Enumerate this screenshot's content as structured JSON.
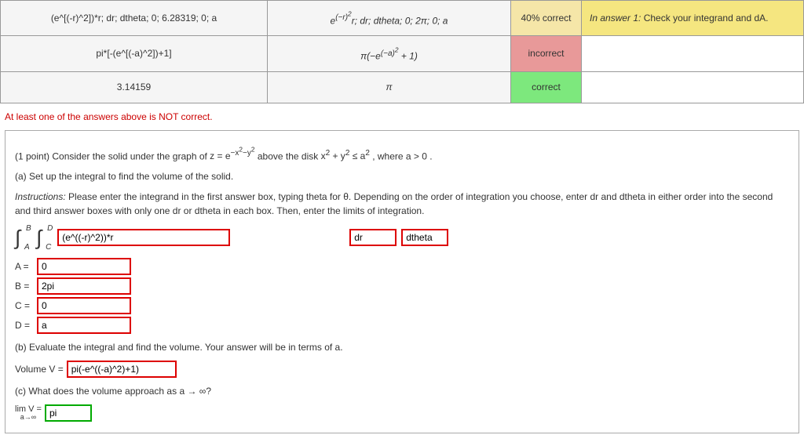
{
  "results": {
    "rows": [
      {
        "entered": "(e^[(-r)^2])*r; dr; dtheta; 0; 6.28319; 0; a",
        "preview_html": "e<sup>(−r)<sup>2</sup></sup>r; dr; dtheta; 0; 2π; 0; a",
        "status": "40% correct",
        "status_class": "status-partial",
        "hint_prefix": "In answer 1:",
        "hint": "Check your integrand and dA."
      },
      {
        "entered": "pi*[-(e^[(-a)^2])+1]",
        "preview_html": "π(−e<sup>(−a)<sup>2</sup></sup> + 1)",
        "status": "incorrect",
        "status_class": "status-incorrect",
        "hint_prefix": "",
        "hint": ""
      },
      {
        "entered": "3.14159",
        "preview_html": "π",
        "status": "correct",
        "status_class": "status-correct",
        "hint_prefix": "",
        "hint": ""
      }
    ]
  },
  "warning": "At least one of the answers above is NOT correct.",
  "problem": {
    "points": "(1 point)",
    "stem1": "Consider the solid under the graph of ",
    "stem_eq_html": "z = e<sup>−x<sup>2</sup>−y<sup>2</sup></sup>",
    "stem2": " above the disk ",
    "stem_disk_html": "x<sup>2</sup> + y<sup>2</sup> ≤ a<sup>2</sup>",
    "stem3": ", where ",
    "stem_cond": "a > 0",
    "stemend": ".",
    "part_a": "(a) Set up the integral to find the volume of the solid.",
    "instructions_label": "Instructions:",
    "instructions": "Please enter the integrand in the first answer box, typing theta for θ. Depending on the order of integration you choose, enter dr and dtheta in either order into the second and third answer boxes with only one dr or dtheta in each box. Then, enter the limits of integration.",
    "integrand_value": "(e^((-r)^2))*r",
    "diff1_value": "dr",
    "diff2_value": "dtheta",
    "limits": {
      "A": "0",
      "B": "2pi",
      "C": "0",
      "D": "a"
    },
    "int_bounds": {
      "outer_upper": "B",
      "outer_lower": "A",
      "inner_upper": "D",
      "inner_lower": "C"
    },
    "part_b": "(b) Evaluate the integral and find the volume. Your answer will be in terms of a.",
    "vol_label": "Volume V = ",
    "vol_value": "pi(-e^((-a)^2)+1)",
    "part_c": "(c) What does the volume approach as a → ∞?",
    "lim_top": "lim V = ",
    "lim_bottom": "a→∞",
    "lim_value": "pi"
  }
}
